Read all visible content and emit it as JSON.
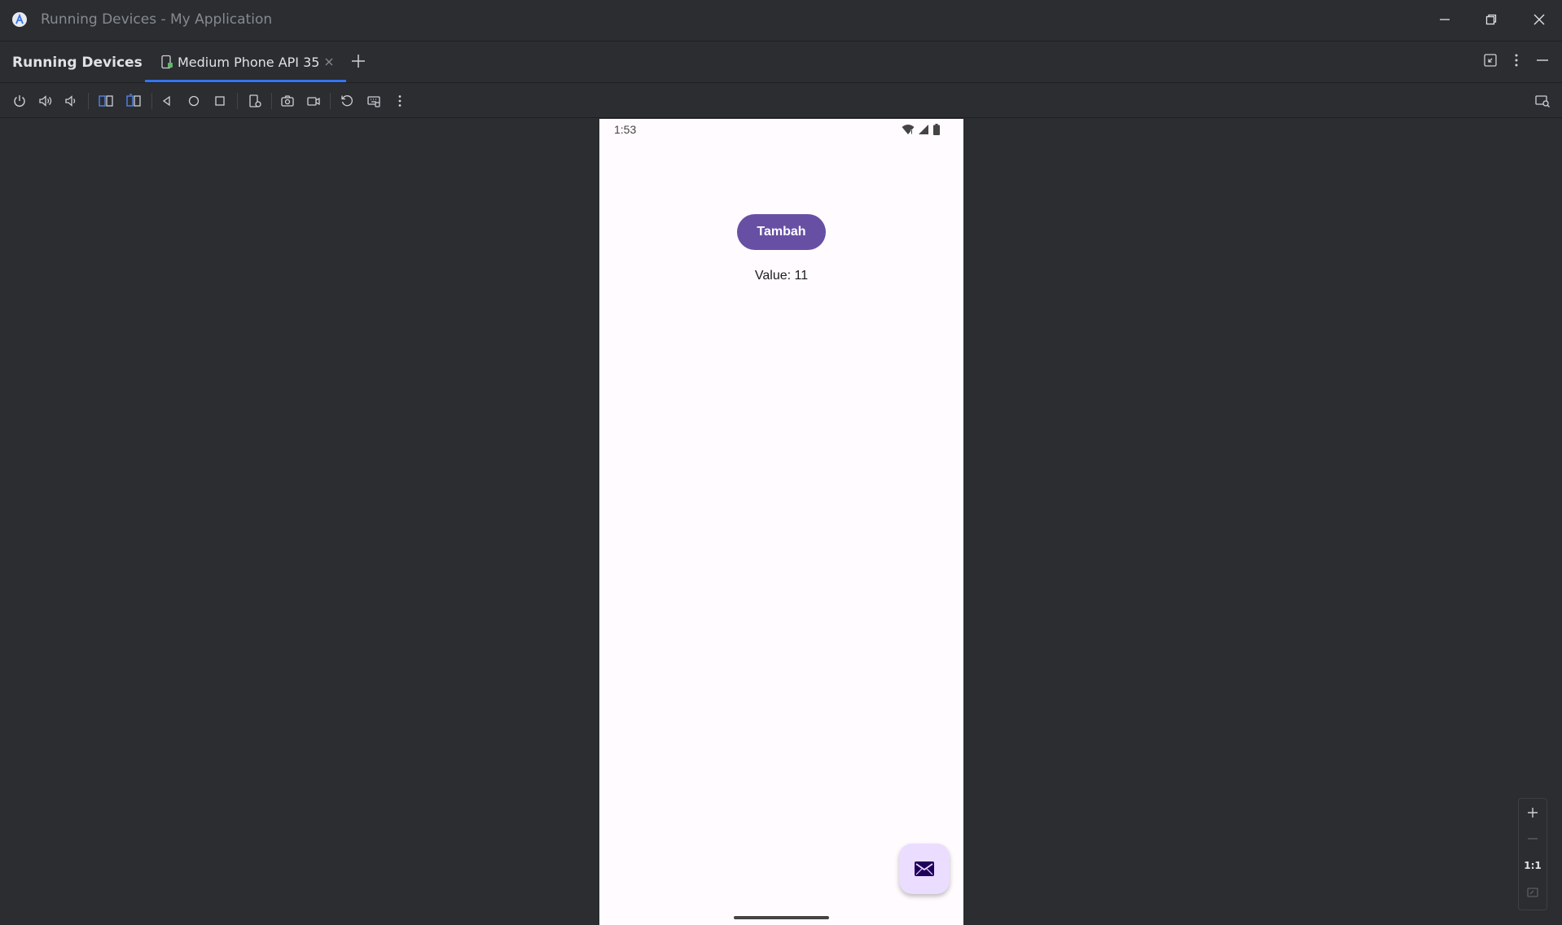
{
  "window": {
    "title": "Running Devices - My Application"
  },
  "tool_window": {
    "title": "Running Devices",
    "tabs": [
      {
        "label": "Medium Phone API 35",
        "active": true
      }
    ]
  },
  "toolbar": {
    "buttons": [
      "power-icon",
      "volume-up-icon",
      "volume-down-icon",
      "rotate-left-icon",
      "rotate-right-icon",
      "back-icon",
      "home-icon",
      "overview-icon",
      "device-settings-icon",
      "screenshot-icon",
      "screen-record-icon",
      "reset-icon",
      "keyboard-input-icon",
      "more-options-icon"
    ],
    "right_button": "device-mirroring-icon"
  },
  "device": {
    "status_time": "1:53",
    "button_label": "Tambah",
    "value_text": "Value: 11"
  },
  "zoom": {
    "actual_size_label": "1:1"
  },
  "colors": {
    "accent": "#3574f0",
    "button_primary": "#6750a4",
    "fab": "#eaddff",
    "ide_background": "#2b2d30"
  }
}
